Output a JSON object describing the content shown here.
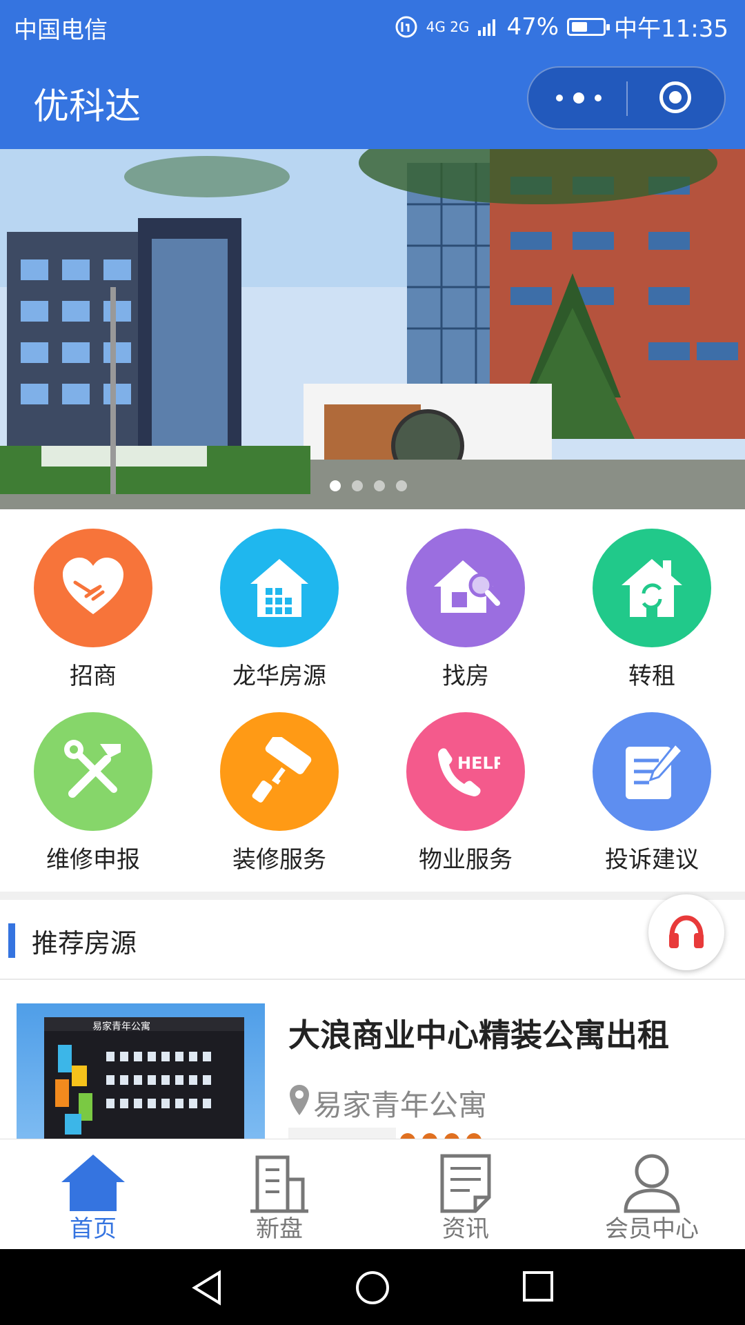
{
  "status_bar": {
    "carrier": "中国电信",
    "network": "4G 2G",
    "battery": "47%",
    "time": "中午11:35"
  },
  "nav": {
    "title": "优科达"
  },
  "banner": {
    "slides": 4,
    "active_index": 0
  },
  "menu": [
    {
      "label": "招商",
      "icon": "handshake-heart-icon",
      "color": "#f7743a"
    },
    {
      "label": "龙华房源",
      "icon": "house-building-icon",
      "color": "#1fb7ee"
    },
    {
      "label": "找房",
      "icon": "house-search-icon",
      "color": "#9b6ee0"
    },
    {
      "label": "转租",
      "icon": "house-refresh-icon",
      "color": "#21c98a"
    },
    {
      "label": "维修申报",
      "icon": "tools-icon",
      "color": "#86d66a"
    },
    {
      "label": "装修服务",
      "icon": "paint-roller-icon",
      "color": "#ff9a15"
    },
    {
      "label": "物业服务",
      "icon": "help-phone-icon",
      "color": "#f45a8c",
      "icon_text": "HELP"
    },
    {
      "label": "投诉建议",
      "icon": "edit-note-icon",
      "color": "#5e8ef0"
    }
  ],
  "section": {
    "title": "推荐房源"
  },
  "listing": {
    "title": "大浪商业中心精装公寓出租",
    "location": "易家青年公寓",
    "thumb_text": "易家青年公寓"
  },
  "tabbar": [
    {
      "label": "首页",
      "icon": "home-icon",
      "active": true
    },
    {
      "label": "新盘",
      "icon": "building-icon",
      "active": false
    },
    {
      "label": "资讯",
      "icon": "news-icon",
      "active": false
    },
    {
      "label": "会员中心",
      "icon": "user-icon",
      "active": false
    }
  ],
  "colors": {
    "primary": "#3574e0",
    "help_red": "#e83a3a"
  }
}
